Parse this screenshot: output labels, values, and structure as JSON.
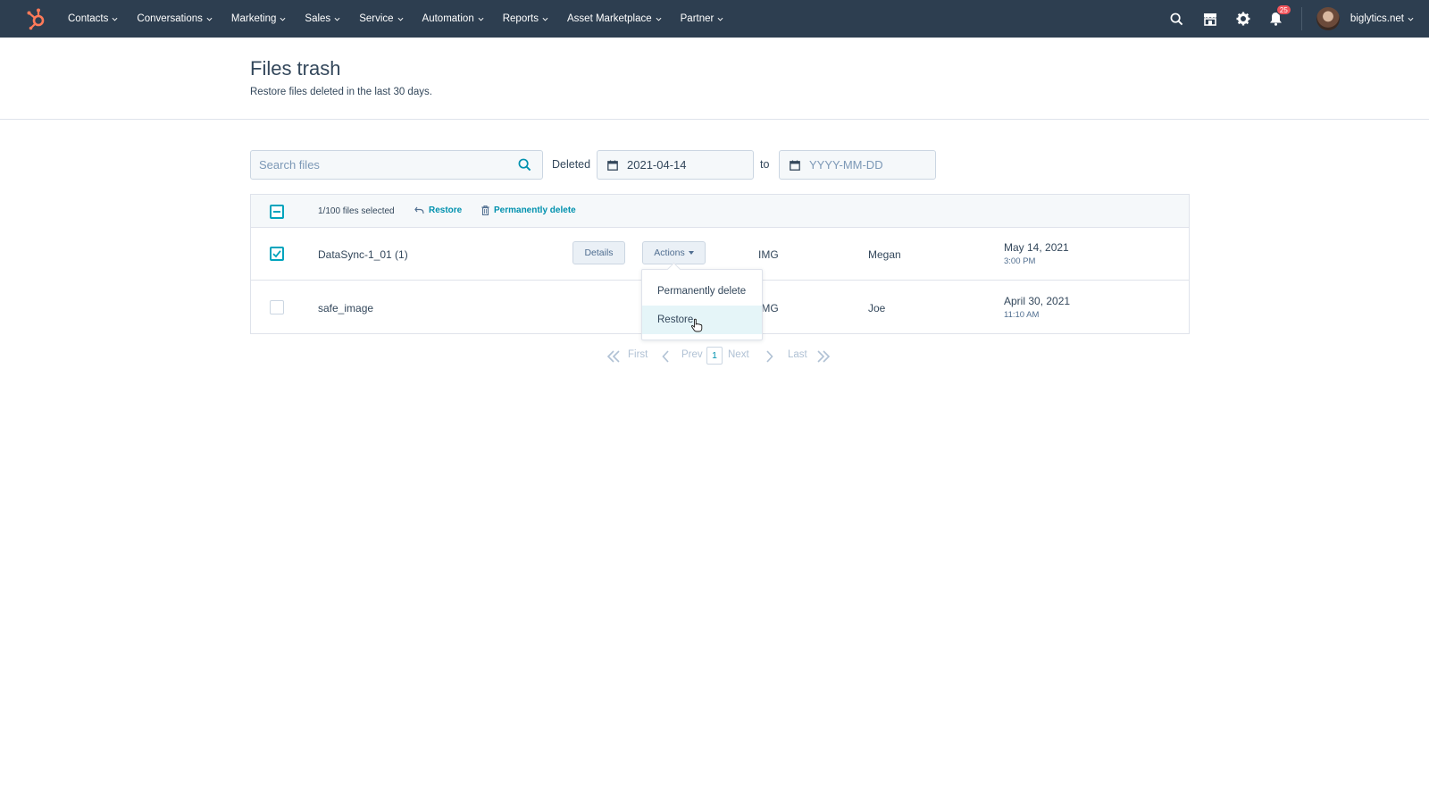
{
  "nav": {
    "items": [
      {
        "label": "Contacts"
      },
      {
        "label": "Conversations"
      },
      {
        "label": "Marketing"
      },
      {
        "label": "Sales"
      },
      {
        "label": "Service"
      },
      {
        "label": "Automation"
      },
      {
        "label": "Reports"
      },
      {
        "label": "Asset Marketplace"
      },
      {
        "label": "Partner"
      }
    ],
    "notification_count": "25",
    "account": "biglytics.net"
  },
  "header": {
    "title": "Files trash",
    "subtitle": "Restore files deleted in the last 30 days."
  },
  "filters": {
    "search_placeholder": "Search files",
    "deleted_label": "Deleted",
    "from_value": "2021-04-14",
    "to_label": "to",
    "to_placeholder": "YYYY-MM-DD"
  },
  "bulk": {
    "count": "1/100 files selected",
    "restore": "Restore",
    "delete": "Permanently delete"
  },
  "rows": [
    {
      "name": "DataSync-1_01 (1)",
      "details": "Details",
      "actions": "Actions",
      "type": "IMG",
      "owner": "Megan",
      "date": "May 14, 2021",
      "time": "3:00 PM",
      "checked": true
    },
    {
      "name": "safe_image",
      "type": "IMG",
      "owner": "Joe",
      "date": "April 30, 2021",
      "time": "11:10 AM",
      "checked": false
    }
  ],
  "dropdown": {
    "items": [
      "Permanently delete",
      "Restore"
    ]
  },
  "pager": {
    "first": "First",
    "prev": "Prev",
    "page": "1",
    "next": "Next",
    "last": "Last"
  },
  "colors": {
    "nav_bg": "#2d3e50",
    "accent": "#00a4bd",
    "link": "#0091ae",
    "logo": "#ff7a59"
  }
}
